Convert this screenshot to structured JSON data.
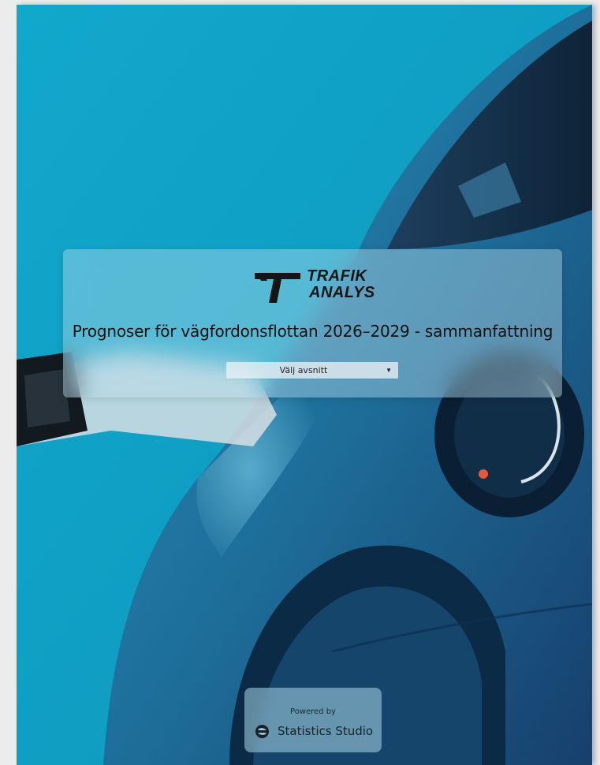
{
  "brand": {
    "logo_line1": "TRAFIK",
    "logo_line2": "ANALYS"
  },
  "report": {
    "title": "Prognoser för vägfordonsflottan 2026–2029 - sammanfattning"
  },
  "section_select": {
    "selected": "Välj avsnitt",
    "caret": "▼"
  },
  "footer": {
    "powered_by": "Powered by",
    "product": "Statistics Studio"
  },
  "icons": {
    "logo": "trafikanalys-t-logo-icon",
    "caret": "caret-down-icon",
    "product": "statistics-studio-logo-icon"
  },
  "colors": {
    "background": "#14a6c9",
    "card": "#b9deec",
    "text": "#111111"
  }
}
